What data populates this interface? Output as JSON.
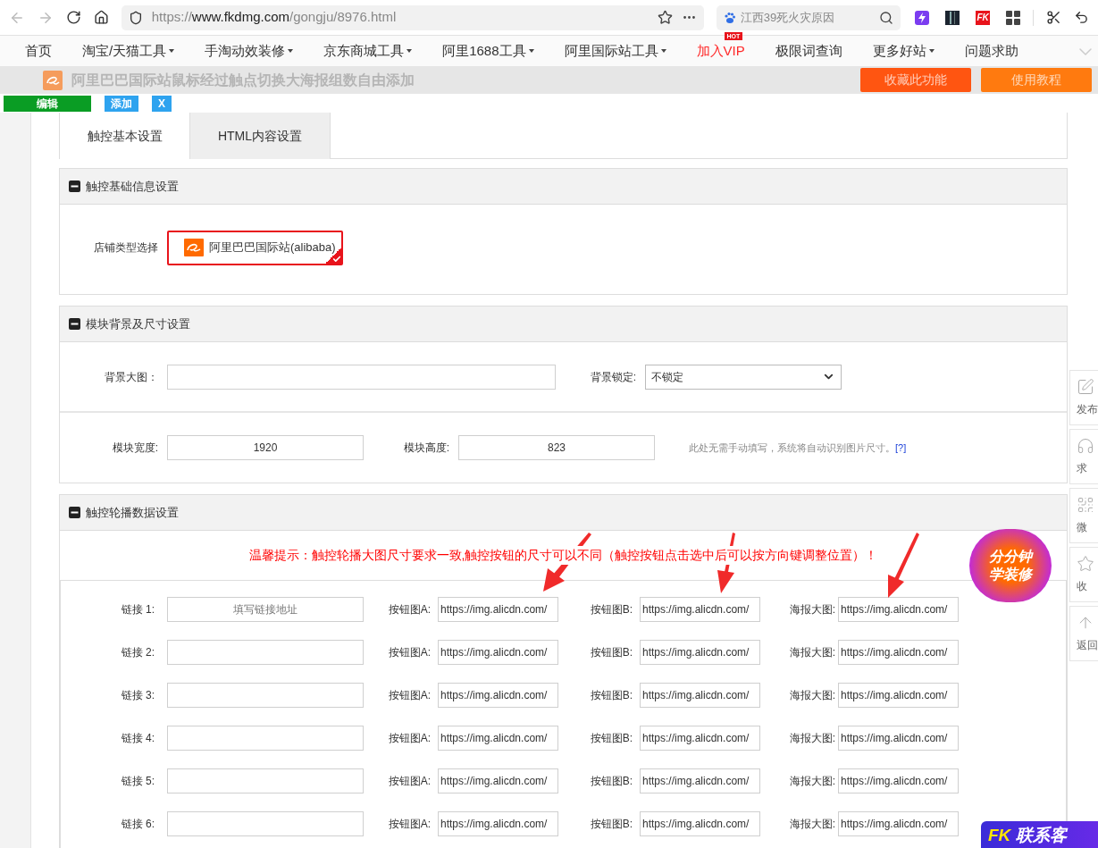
{
  "browser": {
    "url": {
      "scheme": "https://",
      "host": "www.fkdmg.com",
      "path": "/gongju/8976.html"
    },
    "search": "江西39死火灾原因",
    "extensions": [
      {
        "kind": "bolt"
      },
      {
        "kind": "dark"
      },
      {
        "kind": "fk",
        "label": "FK"
      },
      {
        "kind": "grid"
      }
    ]
  },
  "nav": [
    {
      "label": "首页",
      "dropdown": false,
      "highlight": false
    },
    {
      "label": "淘宝/天猫工具",
      "dropdown": true,
      "highlight": false
    },
    {
      "label": "手淘动效装修",
      "dropdown": true,
      "highlight": false
    },
    {
      "label": "京东商城工具",
      "dropdown": true,
      "highlight": false
    },
    {
      "label": "阿里1688工具",
      "dropdown": true,
      "highlight": false
    },
    {
      "label": "阿里国际站工具",
      "dropdown": true,
      "highlight": false
    },
    {
      "label": "加入VIP",
      "dropdown": false,
      "highlight": true,
      "badge": "HOT"
    },
    {
      "label": "极限词查询",
      "dropdown": false,
      "highlight": false
    },
    {
      "label": "更多好站",
      "dropdown": true,
      "highlight": false
    },
    {
      "label": "问题求助",
      "dropdown": false,
      "highlight": false
    }
  ],
  "title_bar": {
    "title": "阿里巴巴国际站鼠标经过触点切换大海报组数自由添加",
    "buttons": [
      {
        "label": "收藏此功能",
        "color": "#ff5511"
      },
      {
        "label": "使用教程",
        "color": "#ff7a0f"
      }
    ]
  },
  "toolbar": [
    {
      "kind": "edit",
      "label": "编辑"
    },
    {
      "kind": "add",
      "label": "添加"
    },
    {
      "kind": "close",
      "label": "X"
    }
  ],
  "tabs": [
    {
      "label": "触控基本设置",
      "selected": true
    },
    {
      "label": "HTML内容设置",
      "selected": false
    }
  ],
  "basic_info": {
    "title": "触控基础信息设置",
    "store_type_label": "店铺类型选择",
    "store_option": {
      "label": "阿里巴巴国际站(alibaba)",
      "selected": true
    }
  },
  "size_settings": {
    "title": "模块背景及尺寸设置",
    "background_label": "背景大图：",
    "lock_label": "背景锁定:",
    "lock_value": "不锁定",
    "width_label": "模块宽度:",
    "width_value": "1920",
    "height_label": "模块高度:",
    "height_value": "823",
    "hint": "此处无需手动填写，系统将自动识别图片尺寸。",
    "hint_link": "[?]"
  },
  "carousel": {
    "title": "触控轮播数据设置",
    "tip": "温馨提示：触控轮播大图尺寸要求一致,触控按钮的尺寸可以不同（触控按钮点击选中后可以按方向键调整位置）！",
    "rows": [
      {
        "link_label": "链接 1:",
        "link_placeholder": "填写链接地址",
        "a_label": "按钮图A:",
        "a_value": "https://img.alicdn.com/",
        "b_label": "按钮图B:",
        "b_value": "https://img.alicdn.com/",
        "poster_label": "海报大图:",
        "poster_value": "https://img.alicdn.com/"
      },
      {
        "link_label": "链接 2:",
        "a_label": "按钮图A:",
        "a_value": "https://img.alicdn.com/",
        "b_label": "按钮图B:",
        "b_value": "https://img.alicdn.com/",
        "poster_label": "海报大图:",
        "poster_value": "https://img.alicdn.com/"
      },
      {
        "link_label": "链接 3:",
        "a_label": "按钮图A:",
        "a_value": "https://img.alicdn.com/",
        "b_label": "按钮图B:",
        "b_value": "https://img.alicdn.com/",
        "poster_label": "海报大图:",
        "poster_value": "https://img.alicdn.com/"
      },
      {
        "link_label": "链接 4:",
        "a_label": "按钮图A:",
        "a_value": "https://img.alicdn.com/",
        "b_label": "按钮图B:",
        "b_value": "https://img.alicdn.com/",
        "poster_label": "海报大图:",
        "poster_value": "https://img.alicdn.com/"
      },
      {
        "link_label": "链接 5:",
        "a_label": "按钮图A:",
        "a_value": "https://img.alicdn.com/",
        "b_label": "按钮图B:",
        "b_value": "https://img.alicdn.com/",
        "poster_label": "海报大图:",
        "poster_value": "https://img.alicdn.com/"
      },
      {
        "link_label": "链接 6:",
        "a_label": "按钮图A:",
        "a_value": "https://img.alicdn.com/",
        "b_label": "按钮图B:",
        "b_value": "https://img.alicdn.com/",
        "poster_label": "海报大图:",
        "poster_value": "https://img.alicdn.com/"
      }
    ]
  },
  "side_float": [
    {
      "kind": "edit",
      "label": "发布"
    },
    {
      "kind": "help",
      "label": "求"
    },
    {
      "kind": "qr",
      "label": "微"
    },
    {
      "kind": "star",
      "label": "收"
    },
    {
      "kind": "top",
      "label": "返回"
    }
  ],
  "promo": {
    "line1": "分分钟",
    "line2": "学装修"
  },
  "contact": {
    "logo": "FK",
    "label": "联系客"
  }
}
